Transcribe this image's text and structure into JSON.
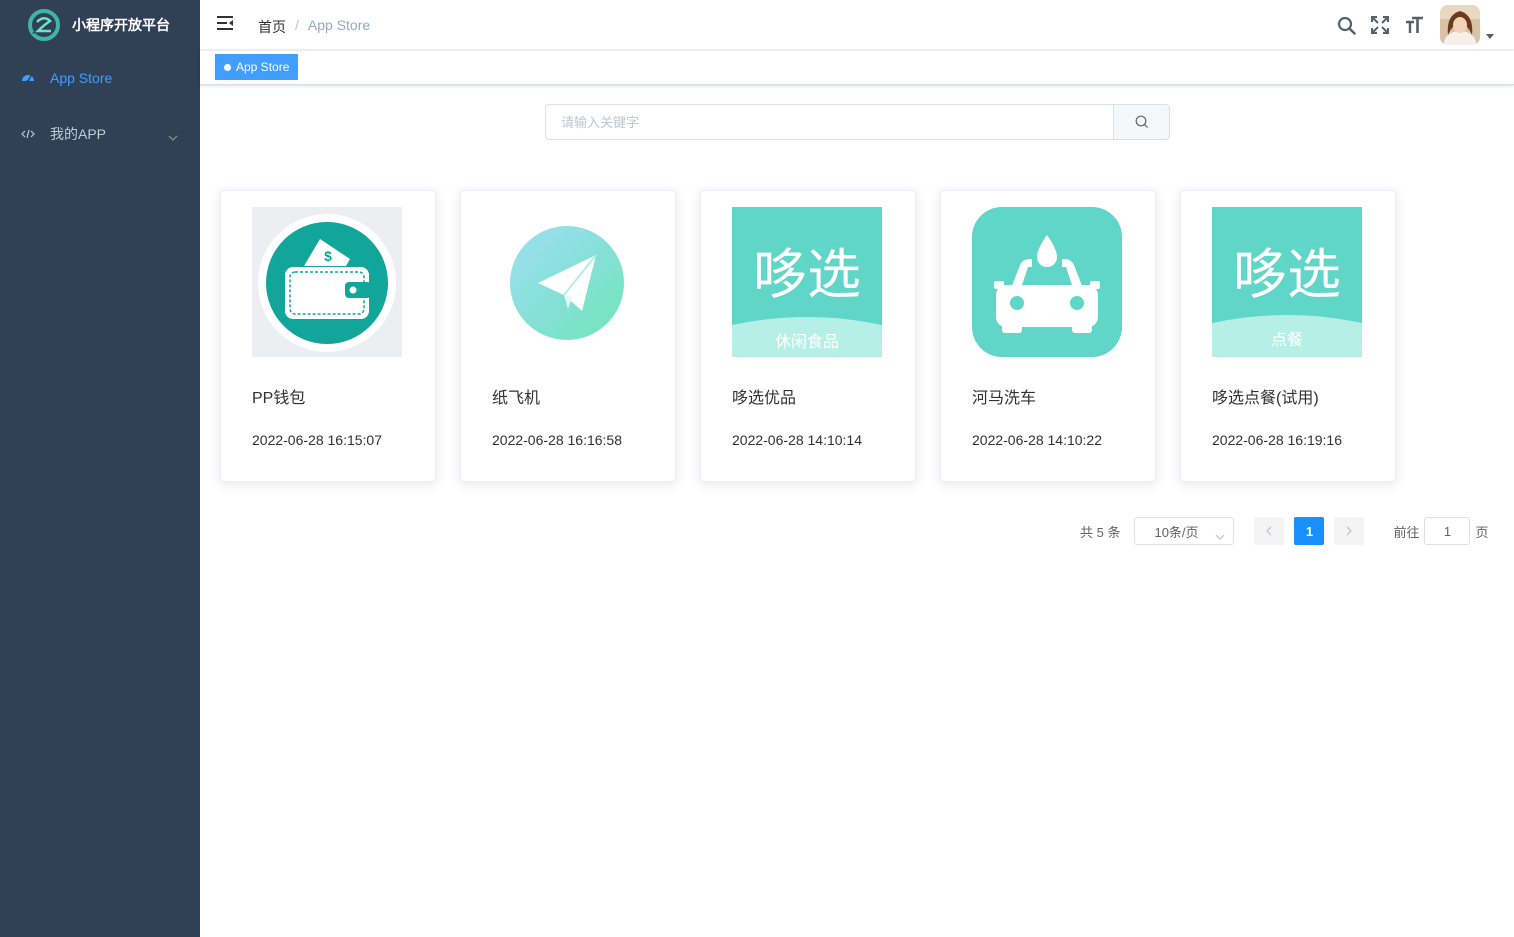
{
  "app": {
    "title": "小程序开放平台"
  },
  "sidebar": {
    "items": [
      {
        "label": "App Store",
        "icon": "dashboard-icon",
        "active": true
      },
      {
        "label": "我的APP",
        "icon": "code-icon",
        "expandable": true
      }
    ]
  },
  "breadcrumb": {
    "home": "首页",
    "separator": "/",
    "current": "App Store"
  },
  "tags": [
    {
      "label": "App Store",
      "active": true
    }
  ],
  "search": {
    "placeholder": "请输入关键字",
    "value": ""
  },
  "apps": [
    {
      "name": "PP钱包",
      "date": "2022-06-28 16:15:07",
      "icon": "wallet-icon"
    },
    {
      "name": "纸飞机",
      "date": "2022-06-28 16:16:58",
      "icon": "paper-plane-icon"
    },
    {
      "name": "哆选优品",
      "date": "2022-06-28 14:10:14",
      "icon": "duoxuan-snacks-icon",
      "icon_text": "哆选",
      "icon_sub": "休闲食品"
    },
    {
      "name": "河马洗车",
      "date": "2022-06-28 14:10:22",
      "icon": "car-wash-icon"
    },
    {
      "name": "哆选点餐(试用)",
      "date": "2022-06-28 16:19:16",
      "icon": "duoxuan-order-icon",
      "icon_text": "哆选",
      "icon_sub": "点餐"
    }
  ],
  "pagination": {
    "total_label": "共 5 条",
    "page_size": "10条/页",
    "current_page": "1",
    "goto_prefix": "前往",
    "goto_value": "1",
    "goto_suffix": "页"
  },
  "colors": {
    "sidebar_bg": "#304156",
    "accent": "#409eff",
    "page_active": "#1890ff",
    "icon_teal": "#5fd6c7"
  }
}
